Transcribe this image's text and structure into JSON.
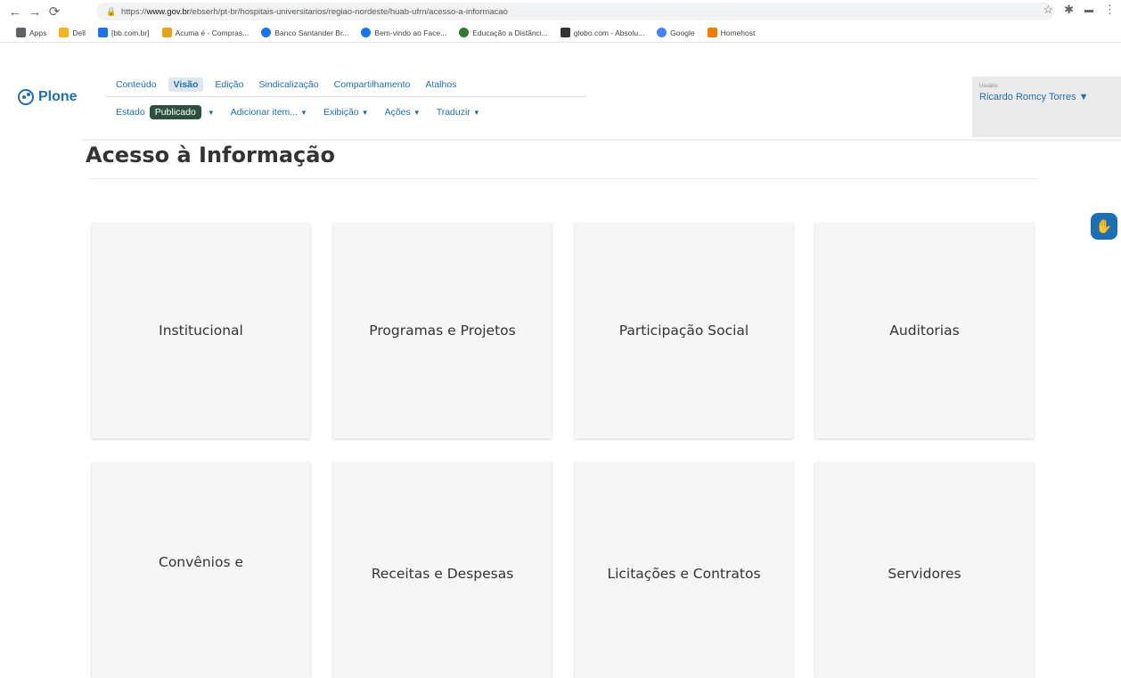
{
  "browser": {
    "url_prefix": "https://",
    "url_host": "www.gov.br",
    "url_path": "/ebserh/pt-br/hospitais-universitarios/regiao-nordeste/huab-ufrn/acesso-a-informacao"
  },
  "bookmarks": [
    {
      "label": "Apps",
      "color": "#5f6368"
    },
    {
      "label": "Dell",
      "color": "#f2b51c"
    },
    {
      "label": "[bb.com.br]",
      "color": "#1a73e8"
    },
    {
      "label": "Acuma é - Compras...",
      "color": "#e8a21a"
    },
    {
      "label": "Banco Santander Br...",
      "color": "#1a73e8"
    },
    {
      "label": "Bem-vindo ao Face...",
      "color": "#1877f2"
    },
    {
      "label": "Educação a Distânci...",
      "color": "#2e7d32"
    },
    {
      "label": "globo.com - Absolu...",
      "color": "#333333"
    },
    {
      "label": "Google",
      "color": "#4285f4"
    },
    {
      "label": "Homehost",
      "color": "#f57c00"
    }
  ],
  "plone": {
    "logo": "Plone",
    "row1": [
      "Conteúdo",
      "Visão",
      "Edição",
      "Sindicalização",
      "Compartilhamento",
      "Atalhos"
    ],
    "active_row1": "Visão",
    "state_label": "Estado",
    "state_value": "Publicado",
    "row2": [
      "Adicionar item...",
      "Exibição",
      "Ações",
      "Traduzir"
    ],
    "user_caption": "Usuário",
    "user_name": "Ricardo Romcy Torres ▼"
  },
  "page": {
    "title": "Acesso à Informação",
    "cards": [
      "Institucional",
      "Programas e Projetos",
      "Participação Social",
      "Auditorias",
      "Convênios e",
      "Receitas e Despesas",
      "Licitações e Contratos",
      "Servidores"
    ]
  }
}
